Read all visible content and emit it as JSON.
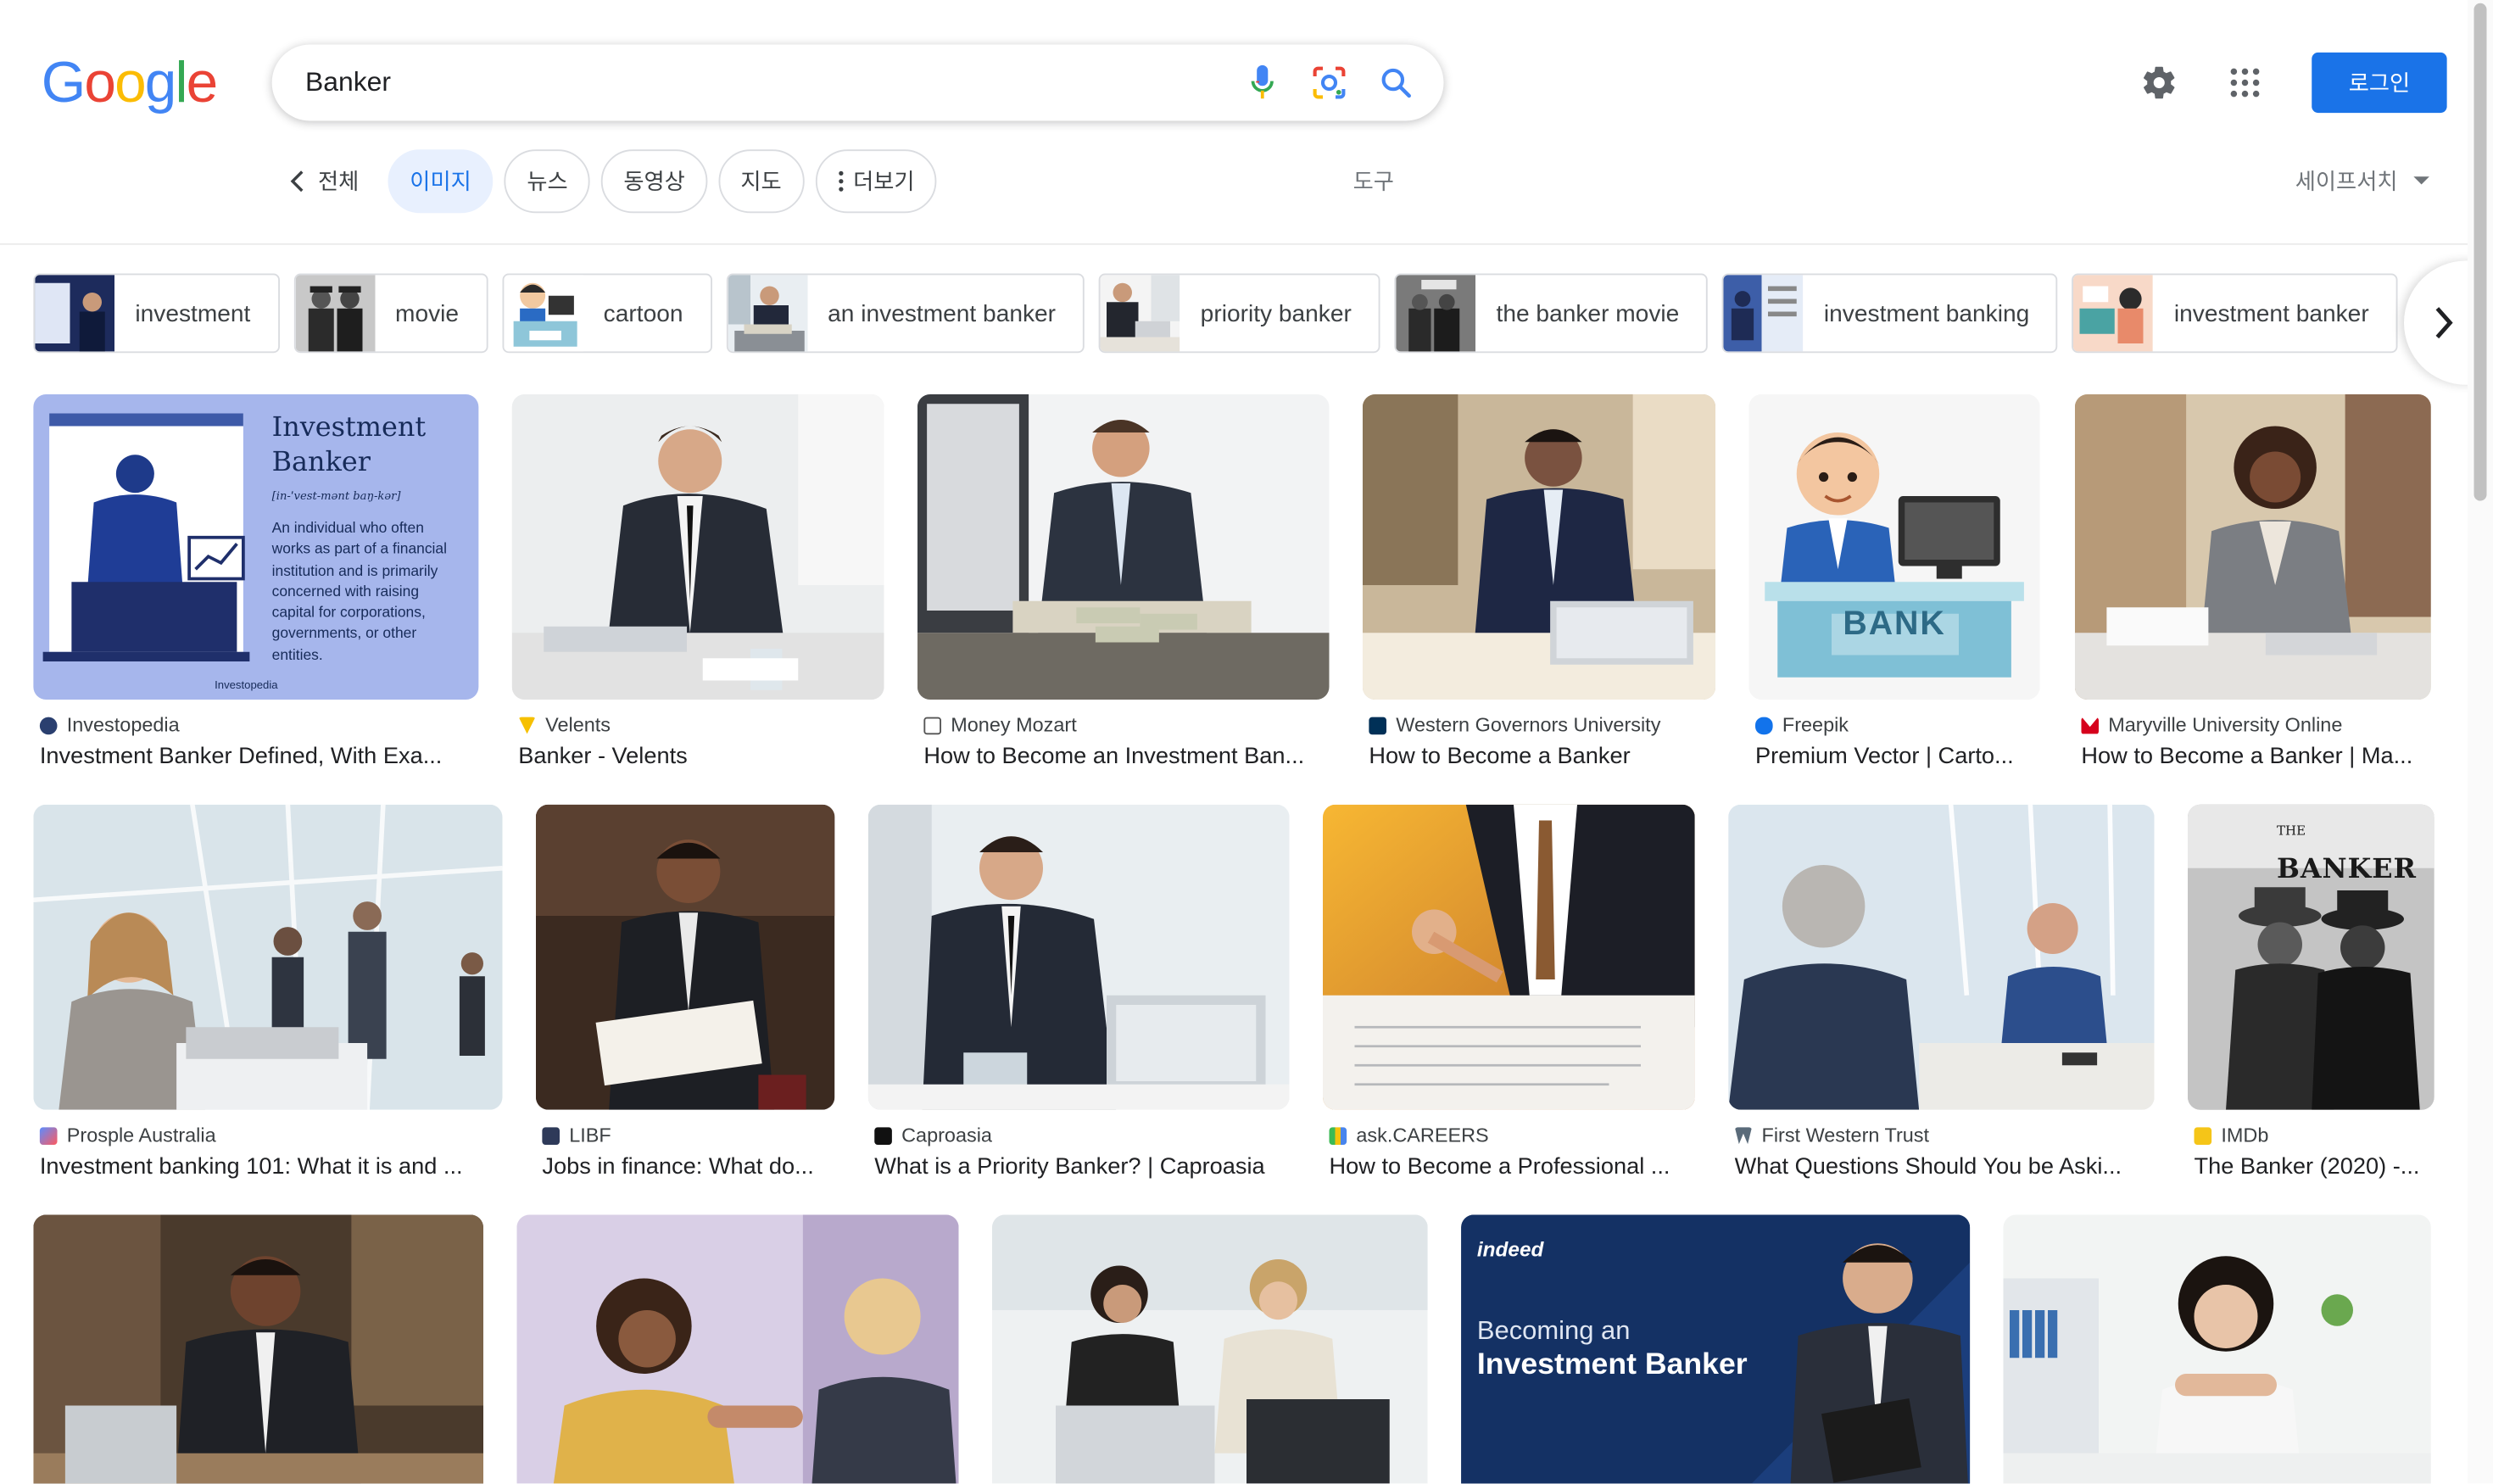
{
  "logo": {
    "letters": [
      "G",
      "o",
      "o",
      "g",
      "l",
      "e"
    ],
    "colors": [
      "#4285F4",
      "#EA4335",
      "#FBBC05",
      "#4285F4",
      "#34A853",
      "#EA4335"
    ]
  },
  "search": {
    "query": "Banker",
    "placeholder": ""
  },
  "header": {
    "login_label": "로그인",
    "accent": "#1a73e8"
  },
  "tabs": {
    "back_label": "전체",
    "items": [
      "이미지",
      "뉴스",
      "동영상",
      "지도",
      "더보기"
    ],
    "active_index": 0,
    "tools_label": "도구",
    "safesearch_label": "세이프서치"
  },
  "chips": [
    "investment",
    "movie",
    "cartoon",
    "an investment banker",
    "priority banker",
    "the banker movie",
    "investment banking",
    "investment banker"
  ],
  "row1": [
    {
      "source": "Investopedia",
      "title": "Investment Banker Defined, With Exa...",
      "img_text": {
        "heading1": "Investment",
        "heading2": "Banker",
        "pron": "[in-ˈvest-mənt baŋ-kər]",
        "body": [
          "An individual who often",
          "works as part of a financial",
          "institution and is primarily",
          "concerned with raising",
          "capital for corporations,",
          "governments, or other",
          "entities."
        ],
        "brand": "Investopedia"
      }
    },
    {
      "source": "Velents",
      "title": "Banker - Velents"
    },
    {
      "source": "Money Mozart",
      "title": "How to Become an Investment Ban..."
    },
    {
      "source": "Western Governors University",
      "title": "How to Become a Banker"
    },
    {
      "source": "Freepik",
      "title": "Premium Vector | Carto...",
      "img_text": {
        "sign": "BANK"
      }
    },
    {
      "source": "Maryville University Online",
      "title": "How to Become a Banker | Ma..."
    }
  ],
  "row2": [
    {
      "source": "Prosple Australia",
      "title": "Investment banking 101: What it is and ..."
    },
    {
      "source": "LIBF",
      "title": "Jobs in finance: What do..."
    },
    {
      "source": "Caproasia",
      "title": "What is a Priority Banker? | Caproasia"
    },
    {
      "source": "ask.CAREERS",
      "title": "How to Become a Professional ..."
    },
    {
      "source": "First Western Trust",
      "title": "What Questions Should You be Aski..."
    },
    {
      "source": "IMDb",
      "title": "The Banker (2020) -...",
      "img_text": {
        "poster_title": "BANKER",
        "poster_the": "THE"
      }
    }
  ],
  "row3": [
    {
      "img_text": {}
    },
    {
      "img_text": {}
    },
    {
      "img_text": {}
    },
    {
      "img_text": {
        "brand": "indeed",
        "line1": "Becoming an",
        "line2": "Investment Banker"
      }
    },
    {
      "img_text": {}
    }
  ]
}
